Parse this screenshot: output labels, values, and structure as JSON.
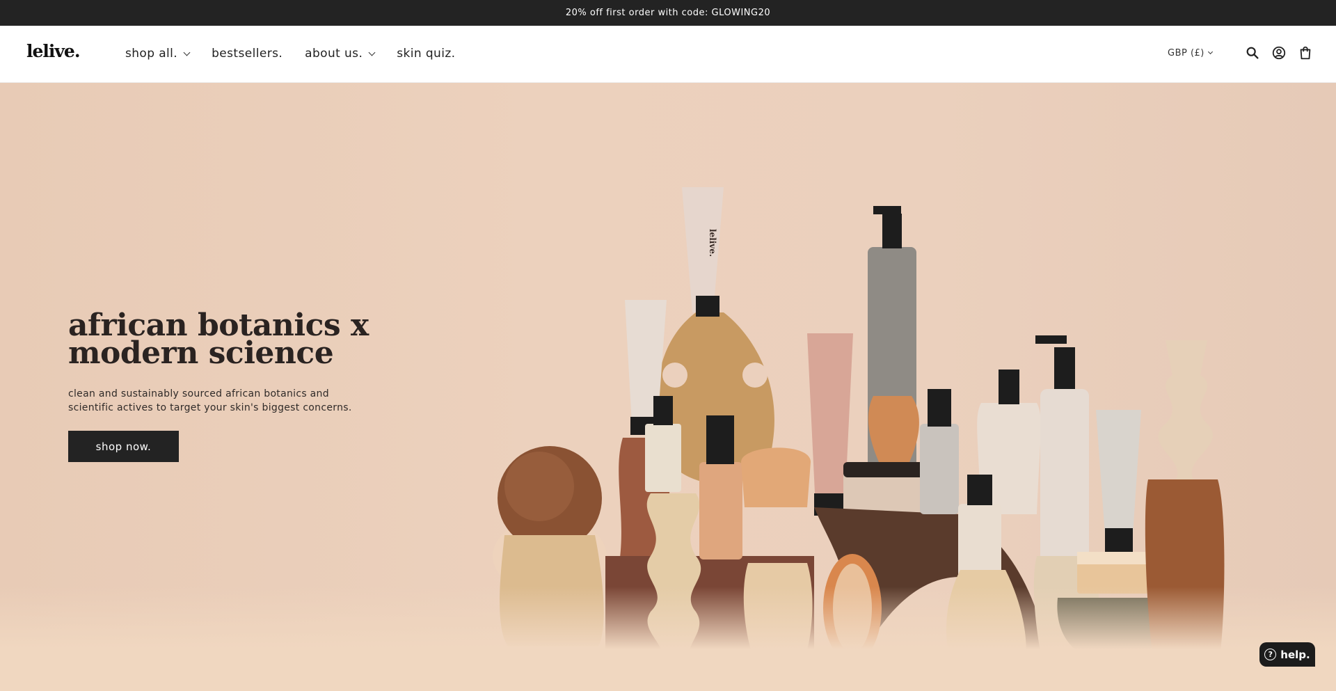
{
  "announcement": "20% off first order with code: GLOWING20",
  "brand": {
    "logo": "lelive."
  },
  "nav": {
    "items": [
      {
        "label": "shop all.",
        "has_dropdown": true
      },
      {
        "label": "bestsellers.",
        "has_dropdown": false
      },
      {
        "label": "about us.",
        "has_dropdown": true
      },
      {
        "label": "skin quiz.",
        "has_dropdown": false
      }
    ]
  },
  "header": {
    "currency": "GBP (£)",
    "icons": [
      "search-icon",
      "account-icon",
      "cart-icon"
    ]
  },
  "hero": {
    "title_line1": "african botanics x",
    "title_line2": "modern science",
    "subtitle_line1": "clean and sustainably sourced african botanics and",
    "subtitle_line2": "scientific actives to target your skin's biggest concerns.",
    "cta": "shop now.",
    "product_label": "lelive."
  },
  "help": {
    "label": "help."
  },
  "colors": {
    "announcement_bg": "#232323",
    "hero_bg": "#ecd1bd",
    "button_bg": "#232323"
  }
}
